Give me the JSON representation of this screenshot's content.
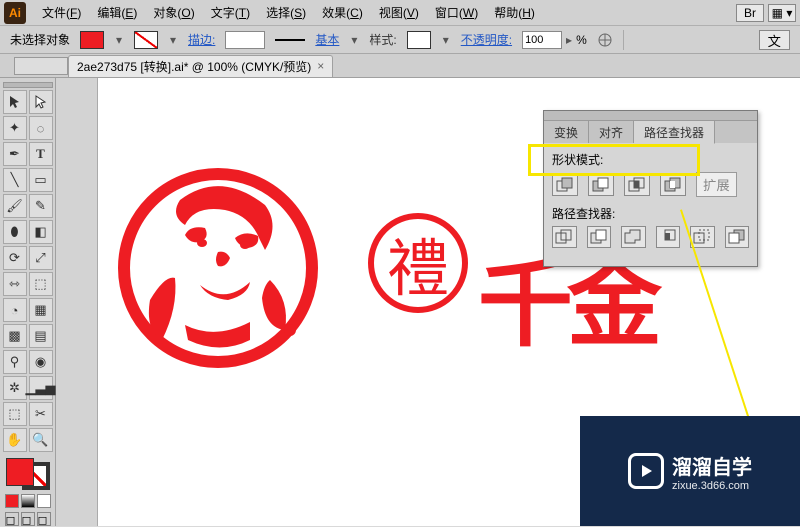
{
  "app": {
    "logo": "Ai"
  },
  "menu": {
    "file": {
      "label": "文件",
      "accel": "F"
    },
    "edit": {
      "label": "编辑",
      "accel": "E"
    },
    "object": {
      "label": "对象",
      "accel": "O"
    },
    "type": {
      "label": "文字",
      "accel": "T"
    },
    "select": {
      "label": "选择",
      "accel": "S"
    },
    "effect": {
      "label": "效果",
      "accel": "C"
    },
    "view": {
      "label": "视图",
      "accel": "V"
    },
    "window": {
      "label": "窗口",
      "accel": "W"
    },
    "help": {
      "label": "帮助",
      "accel": "H"
    }
  },
  "controlbar": {
    "selection_status": "未选择对象",
    "stroke_label": "描边:",
    "stroke_value": "",
    "basic_label": "基本",
    "style_label": "样式:",
    "opacity_label": "不透明度:",
    "opacity_value": "100",
    "opacity_unit": "%",
    "right_button": "文"
  },
  "tabs": {
    "doc1": "2ae273d75 [转换].ai* @ 100% (CMYK/预览)"
  },
  "artwork": {
    "calligraphy_text": "千金",
    "seal_char": "禮"
  },
  "colors": {
    "accent_red": "#ee1d23",
    "highlight_yellow": "#f7e600",
    "panel_bg": "#d6d6d6"
  },
  "pathfinder": {
    "tabs": {
      "transform": "变换",
      "align": "对齐",
      "pathfinder": "路径查找器"
    },
    "shape_modes_label": "形状模式:",
    "pathfinders_label": "路径查找器:",
    "expand_label": "扩展",
    "shape_mode_names": [
      "unite",
      "minus-front",
      "intersect",
      "exclude"
    ],
    "pathfinder_names": [
      "divide",
      "trim",
      "merge",
      "crop",
      "outline",
      "minus-back"
    ]
  },
  "brand": {
    "main": "溜溜自学",
    "sub": "zixue.3d66.com"
  }
}
